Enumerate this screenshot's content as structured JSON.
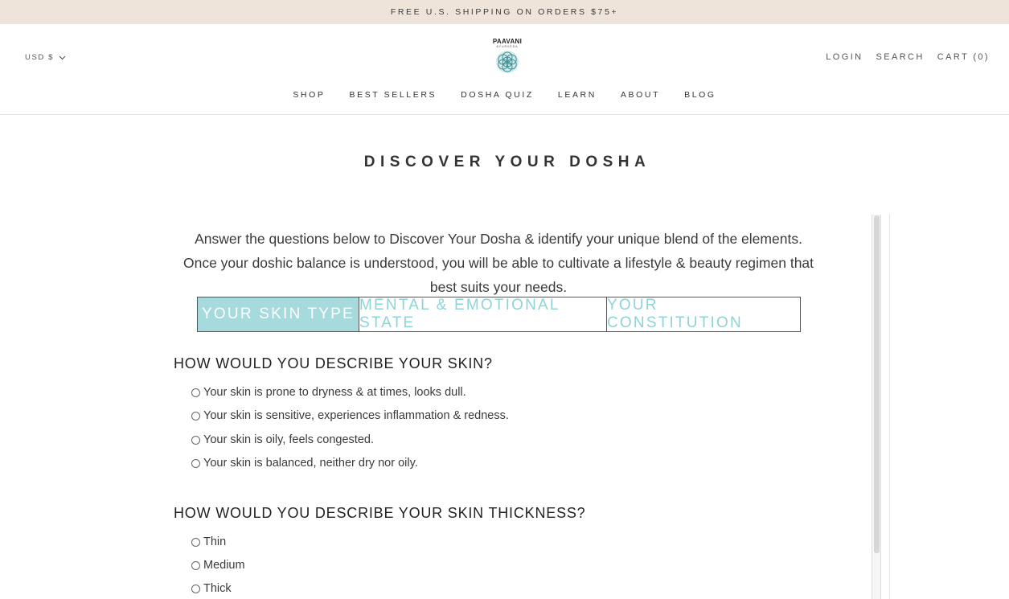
{
  "announcement": "FREE U.S. SHIPPING ON ORDERS $75+",
  "header": {
    "currency": "USD $",
    "logo": {
      "name": "PAAVANI",
      "sub": "AYURVEDA"
    },
    "links": {
      "login": "LOGIN",
      "search": "SEARCH",
      "cart": "CART (0)"
    }
  },
  "nav": [
    "SHOP",
    "BEST SELLERS",
    "DOSHA QUIZ",
    "LEARN",
    "ABOUT",
    "BLOG"
  ],
  "page_title": "DISCOVER YOUR DOSHA",
  "intro": "Answer the questions below to Discover Your Dosha & identify your unique blend of the elements. Once your doshic balance is understood, you will be able to cultivate a lifestyle & beauty regimen that best suits your needs.",
  "tabs": [
    {
      "label": "YOUR SKIN TYPE",
      "active": true
    },
    {
      "label": "MENTAL & EMOTIONAL STATE",
      "active": false
    },
    {
      "label": "YOUR CONSTITUTION",
      "active": false
    }
  ],
  "questions": [
    {
      "title": "HOW WOULD YOU DESCRIBE YOUR SKIN?",
      "options": [
        "Your skin is prone to dryness & at times, looks dull.",
        "Your skin is sensitive, experiences inflammation & redness.",
        "Your skin is oily, feels congested.",
        "Your skin is balanced, neither dry nor oily."
      ]
    },
    {
      "title": "HOW WOULD YOU DESCRIBE YOUR SKIN THICKNESS?",
      "options": [
        "Thin",
        "Medium",
        "Thick"
      ]
    }
  ],
  "colors": {
    "announcement_bg": "#efe4da",
    "tab_active_bg": "#a6dadc",
    "tab_inactive_text": "#8fd3d6"
  }
}
